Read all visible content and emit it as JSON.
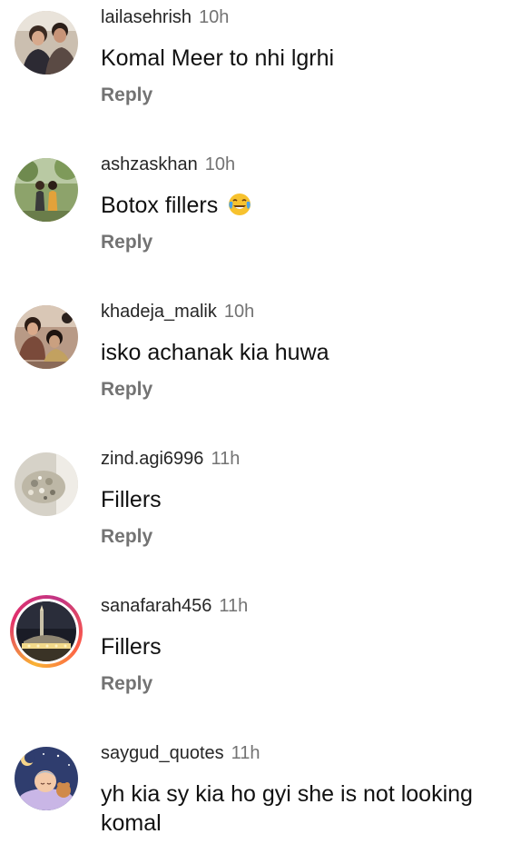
{
  "comments": [
    {
      "username": "lailasehrish",
      "time": "10h",
      "text": "Komal Meer to nhi lgrhi",
      "reply_label": "Reply",
      "avatar_icon": "couple-photo-avatar"
    },
    {
      "username": "ashzaskhan",
      "time": "10h",
      "text": "Botox fillers",
      "emoji": "face-with-tears-of-joy",
      "reply_label": "Reply",
      "avatar_icon": "outdoor-people-avatar"
    },
    {
      "username": "khadeja_malik",
      "time": "10h",
      "text": "isko achanak kia huwa",
      "reply_label": "Reply",
      "avatar_icon": "group-photo-avatar"
    },
    {
      "username": "zind.agi6996",
      "time": "11h",
      "text": "Fillers",
      "reply_label": "Reply",
      "avatar_icon": "jewelry-avatar"
    },
    {
      "username": "sanafarah456",
      "time": "11h",
      "text": "Fillers",
      "reply_label": "Reply",
      "avatar_icon": "mosque-night-avatar",
      "has_story_ring": true
    },
    {
      "username": "saygud_quotes",
      "time": "11h",
      "text": "yh kia sy kia ho gyi she is not looking komal",
      "avatar_icon": "sleeping-baby-moon-avatar"
    }
  ],
  "colors": {
    "text": "#111111",
    "username": "#262626",
    "secondary": "#737373",
    "story_ring": [
      "#f9b233",
      "#e1306c",
      "#c13584"
    ]
  }
}
